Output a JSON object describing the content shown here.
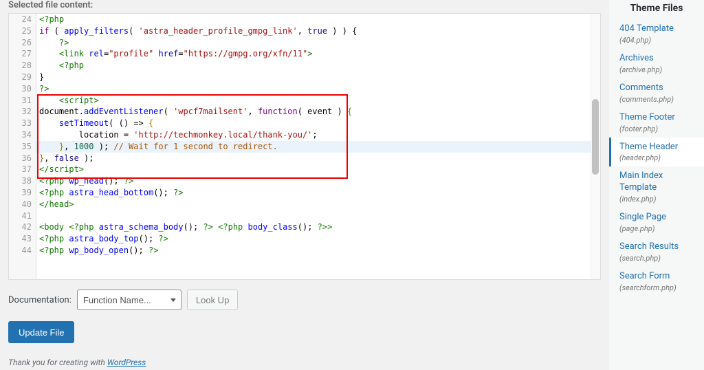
{
  "header": {
    "section": "Selected file content:"
  },
  "editor": {
    "startLine": 24,
    "activeLineIndex": 11,
    "lines": [
      [
        {
          "cls": "tk-tag",
          "t": "<?php"
        }
      ],
      [
        {
          "cls": "tk-kw",
          "t": "if"
        },
        {
          "cls": "tk-punc",
          "t": " ( "
        },
        {
          "cls": "tk-fn",
          "t": "apply_filters"
        },
        {
          "cls": "tk-punc",
          "t": "( "
        },
        {
          "cls": "tk-str",
          "t": "'astra_header_profile_gmpg_link'"
        },
        {
          "cls": "tk-punc",
          "t": ", "
        },
        {
          "cls": "tk-bool",
          "t": "true"
        },
        {
          "cls": "tk-punc",
          "t": " ) ) {"
        }
      ],
      [
        {
          "cls": "tk-punc",
          "t": "    "
        },
        {
          "cls": "tk-tag",
          "t": "?>"
        }
      ],
      [
        {
          "cls": "tk-punc",
          "t": "    "
        },
        {
          "cls": "tk-tag",
          "t": "<link"
        },
        {
          "cls": "tk-punc",
          "t": " "
        },
        {
          "cls": "tk-attr",
          "t": "rel"
        },
        {
          "cls": "tk-punc",
          "t": "="
        },
        {
          "cls": "tk-str",
          "t": "\"profile\""
        },
        {
          "cls": "tk-punc",
          "t": " "
        },
        {
          "cls": "tk-attr",
          "t": "href"
        },
        {
          "cls": "tk-punc",
          "t": "="
        },
        {
          "cls": "tk-str",
          "t": "\"https://gmpg.org/xfn/11\""
        },
        {
          "cls": "tk-tag",
          "t": ">"
        }
      ],
      [
        {
          "cls": "tk-punc",
          "t": "    "
        },
        {
          "cls": "tk-tag",
          "t": "<?php"
        }
      ],
      [
        {
          "cls": "tk-punc",
          "t": "}"
        }
      ],
      [
        {
          "cls": "tk-tag",
          "t": "?>"
        }
      ],
      [
        {
          "cls": "tk-punc",
          "t": "    "
        },
        {
          "cls": "tk-tag",
          "t": "<script>"
        }
      ],
      [
        {
          "cls": "tk-var",
          "t": "document"
        },
        {
          "cls": "tk-punc",
          "t": "."
        },
        {
          "cls": "tk-fn",
          "t": "addEventListener"
        },
        {
          "cls": "tk-punc",
          "t": "( "
        },
        {
          "cls": "tk-str",
          "t": "'wpcf7mailsent'"
        },
        {
          "cls": "tk-punc",
          "t": ", "
        },
        {
          "cls": "tk-kw",
          "t": "function"
        },
        {
          "cls": "tk-punc",
          "t": "( "
        },
        {
          "cls": "tk-var",
          "t": "event"
        },
        {
          "cls": "tk-punc",
          "t": " ) "
        },
        {
          "cls": "tk-brace",
          "t": "{"
        }
      ],
      [
        {
          "cls": "tk-punc",
          "t": "    "
        },
        {
          "cls": "tk-fn",
          "t": "setTimeout"
        },
        {
          "cls": "tk-punc",
          "t": "( () "
        },
        {
          "cls": "tk-punc",
          "t": "=>"
        },
        {
          "cls": "tk-punc",
          "t": " "
        },
        {
          "cls": "tk-brace",
          "t": "{"
        }
      ],
      [
        {
          "cls": "tk-punc",
          "t": "        location "
        },
        {
          "cls": "tk-punc",
          "t": "= "
        },
        {
          "cls": "tk-str",
          "t": "'http://techmonkey.local/thank-you/'"
        },
        {
          "cls": "tk-punc",
          "t": ";"
        }
      ],
      [
        {
          "cls": "tk-punc",
          "t": "    "
        },
        {
          "cls": "tk-brace",
          "t": "}"
        },
        {
          "cls": "tk-punc",
          "t": ", "
        },
        {
          "cls": "tk-num",
          "t": "1000"
        },
        {
          "cls": "tk-punc",
          "t": " ); "
        },
        {
          "cls": "tk-com",
          "t": "// Wait for 1 second to redirect."
        }
      ],
      [
        {
          "cls": "tk-brace",
          "t": "}"
        },
        {
          "cls": "tk-punc",
          "t": ", "
        },
        {
          "cls": "tk-bool",
          "t": "false"
        },
        {
          "cls": "tk-punc",
          "t": " );"
        }
      ],
      [
        {
          "cls": "tk-tag",
          "t": "</script>"
        }
      ],
      [
        {
          "cls": "tk-tag",
          "t": "<?php"
        },
        {
          "cls": "tk-punc",
          "t": " "
        },
        {
          "cls": "tk-fn",
          "t": "wp_head"
        },
        {
          "cls": "tk-punc",
          "t": "(); "
        },
        {
          "cls": "tk-tag",
          "t": "?>"
        }
      ],
      [
        {
          "cls": "tk-tag",
          "t": "<?php"
        },
        {
          "cls": "tk-punc",
          "t": " "
        },
        {
          "cls": "tk-fn",
          "t": "astra_head_bottom"
        },
        {
          "cls": "tk-punc",
          "t": "(); "
        },
        {
          "cls": "tk-tag",
          "t": "?>"
        }
      ],
      [
        {
          "cls": "tk-tag",
          "t": "</head>"
        }
      ],
      [
        {
          "cls": "",
          "t": " "
        }
      ],
      [
        {
          "cls": "tk-tag",
          "t": "<body"
        },
        {
          "cls": "tk-punc",
          "t": " "
        },
        {
          "cls": "tk-tag",
          "t": "<?php"
        },
        {
          "cls": "tk-punc",
          "t": " "
        },
        {
          "cls": "tk-fn",
          "t": "astra_schema_body"
        },
        {
          "cls": "tk-punc",
          "t": "(); "
        },
        {
          "cls": "tk-tag",
          "t": "?>"
        },
        {
          "cls": "tk-punc",
          "t": " "
        },
        {
          "cls": "tk-tag",
          "t": "<?php"
        },
        {
          "cls": "tk-punc",
          "t": " "
        },
        {
          "cls": "tk-fn",
          "t": "body_class"
        },
        {
          "cls": "tk-punc",
          "t": "(); "
        },
        {
          "cls": "tk-tag",
          "t": "?>"
        },
        {
          "cls": "tk-tag",
          "t": ">"
        }
      ],
      [
        {
          "cls": "tk-tag",
          "t": "<?php"
        },
        {
          "cls": "tk-punc",
          "t": " "
        },
        {
          "cls": "tk-fn",
          "t": "astra_body_top"
        },
        {
          "cls": "tk-punc",
          "t": "(); "
        },
        {
          "cls": "tk-tag",
          "t": "?>"
        }
      ],
      [
        {
          "cls": "tk-tag",
          "t": "<?php"
        },
        {
          "cls": "tk-punc",
          "t": " "
        },
        {
          "cls": "tk-fn",
          "t": "wp_body_open"
        },
        {
          "cls": "tk-punc",
          "t": "(); "
        },
        {
          "cls": "tk-tag",
          "t": "?>"
        }
      ]
    ]
  },
  "below": {
    "docLabel": "Documentation:",
    "selectValue": "Function Name...",
    "lookup": "Look Up",
    "update": "Update File"
  },
  "footer": {
    "prefix": "Thank you for creating with ",
    "link": "WordPress"
  },
  "sidebar": {
    "title": "Theme Files",
    "files": [
      {
        "name": "404 Template",
        "path": "(404.php)",
        "active": false
      },
      {
        "name": "Archives",
        "path": "(archive.php)",
        "active": false
      },
      {
        "name": "Comments",
        "path": "(comments.php)",
        "active": false
      },
      {
        "name": "Theme Footer",
        "path": "(footer.php)",
        "active": false
      },
      {
        "name": "Theme Header",
        "path": "(header.php)",
        "active": true
      },
      {
        "name": "Main Index Template",
        "path": "(index.php)",
        "active": false
      },
      {
        "name": "Single Page",
        "path": "(page.php)",
        "active": false
      },
      {
        "name": "Search Results",
        "path": "(search.php)",
        "active": false
      },
      {
        "name": "Search Form",
        "path": "(searchform.php)",
        "active": false
      }
    ]
  }
}
